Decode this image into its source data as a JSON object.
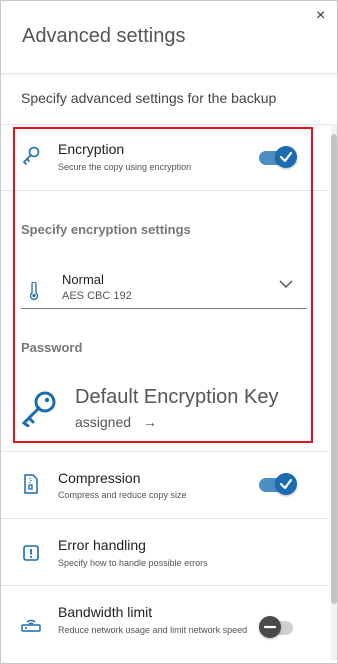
{
  "header": {
    "title": "Advanced settings",
    "close": "×"
  },
  "subtitle": "Specify advanced settings for the backup",
  "encryption": {
    "title": "Encryption",
    "description": "Secure the copy using encryption",
    "enabled": true,
    "settings_label": "Specify encryption settings",
    "select": {
      "label": "Normal",
      "value": "AES CBC 192"
    },
    "password_label": "Password",
    "key_title": "Default Encryption Key",
    "key_status": "assigned",
    "key_arrow": "→"
  },
  "compression": {
    "title": "Compression",
    "description": "Compress and reduce copy size",
    "enabled": true
  },
  "error_handling": {
    "title": "Error handling",
    "description": "Specify how to handle possible errors"
  },
  "bandwidth": {
    "title": "Bandwidth limit",
    "description": "Reduce network usage and limit network speed",
    "enabled": false
  },
  "colors": {
    "accent": "#1a6bb0",
    "highlight": "#e0141e"
  }
}
